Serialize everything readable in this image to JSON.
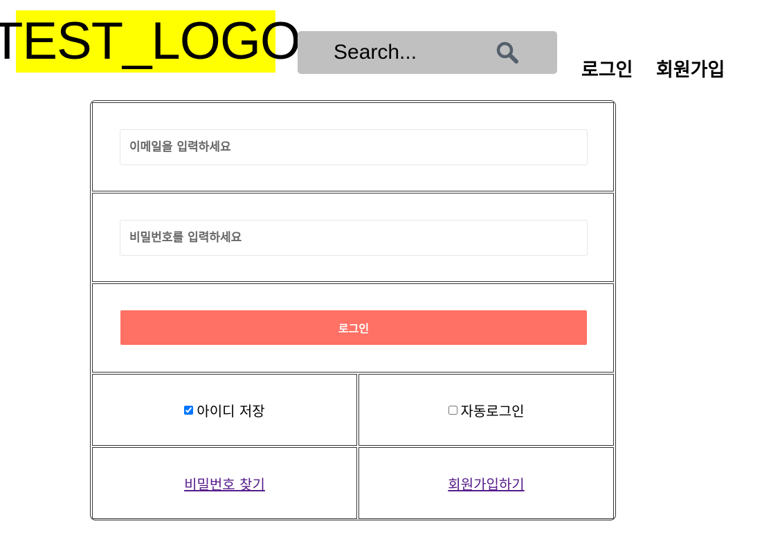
{
  "header": {
    "logo_text": "TEST_LOGO",
    "logo_bg": "#ffff00",
    "search": {
      "placeholder": "Search...",
      "bg": "#c0c0c0",
      "icon": "search-icon"
    },
    "nav": {
      "login": "로그인",
      "signup": "회원가입"
    }
  },
  "form": {
    "email_placeholder": "이메일을 입력하세요",
    "password_placeholder": "비밀번호를 입력하세요",
    "login_button": "로그인",
    "login_button_color": "#ff7065",
    "options": {
      "save_id": {
        "label": "아이디 저장",
        "checked": true
      },
      "auto_login": {
        "label": "자동로그인",
        "checked": false
      }
    },
    "links": {
      "find_password": "비밀번호 찾기",
      "register": "회원가입하기"
    }
  }
}
